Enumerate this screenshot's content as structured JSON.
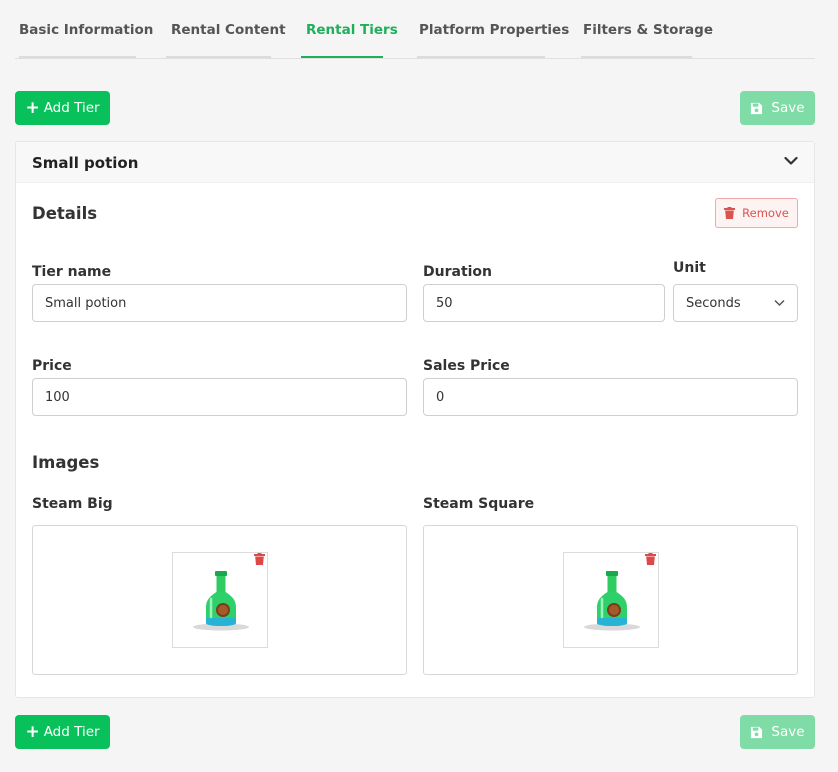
{
  "tabs": [
    {
      "label": "Basic Information"
    },
    {
      "label": "Rental Content"
    },
    {
      "label": "Rental Tiers"
    },
    {
      "label": "Platform Properties"
    },
    {
      "label": "Filters & Storage"
    }
  ],
  "toolbar": {
    "add_label": "Add Tier",
    "save_label": "Save"
  },
  "tier": {
    "header_title": "Small potion",
    "details_title": "Details",
    "remove_label": "Remove",
    "fields": {
      "tier_name": {
        "label": "Tier name",
        "value": "Small potion"
      },
      "duration": {
        "label": "Duration",
        "value": "50"
      },
      "unit": {
        "label": "Unit",
        "value": "Seconds"
      },
      "price": {
        "label": "Price",
        "value": "100"
      },
      "sales_price": {
        "label": "Sales Price",
        "value": "0"
      }
    },
    "images_title": "Images",
    "images": [
      {
        "label": "Steam Big",
        "icon": "potion-bottle-icon"
      },
      {
        "label": "Steam Square",
        "icon": "potion-bottle-icon"
      }
    ]
  },
  "colors": {
    "accent": "#09c15b",
    "active_tab": "#1eaf5a",
    "save_disabled": "#7fdca6",
    "danger": "#d9534f"
  }
}
